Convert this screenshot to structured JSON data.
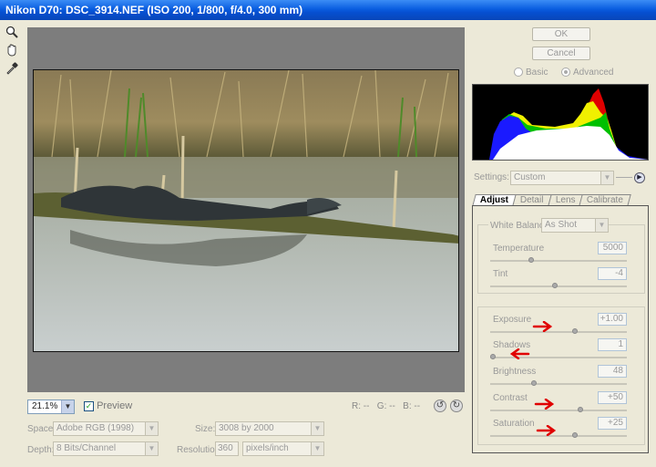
{
  "window": {
    "title": "Nikon D70:  DSC_3914.NEF  (ISO 200, 1/800, f/4.0, 300 mm)"
  },
  "tools": [
    {
      "name": "zoom-tool-icon"
    },
    {
      "name": "hand-tool-icon"
    },
    {
      "name": "white-balance-eyedropper-icon"
    }
  ],
  "buttons": {
    "ok": "OK",
    "cancel": "Cancel"
  },
  "mode": {
    "basic": "Basic",
    "advanced": "Advanced",
    "selected": "Advanced"
  },
  "preview": {
    "zoom": "21.1%",
    "preview_label": "Preview",
    "preview_checked": true,
    "r_label": "R:",
    "g_label": "G:",
    "b_label": "B:",
    "r_value": "--",
    "g_value": "--",
    "b_value": "--"
  },
  "output": {
    "space_label": "Space:",
    "space_value": "Adobe RGB (1998)",
    "size_label": "Size:",
    "size_value": "3008 by 2000",
    "depth_label": "Depth:",
    "depth_value": "8 Bits/Channel",
    "resolution_label": "Resolution:",
    "resolution_value": "360",
    "resolution_unit": "pixels/inch"
  },
  "settings": {
    "label": "Settings:",
    "value": "Custom"
  },
  "tabs": [
    "Adjust",
    "Detail",
    "Lens",
    "Calibrate"
  ],
  "active_tab": "Adjust",
  "white_balance": {
    "label": "White Balance:",
    "value": "As Shot"
  },
  "sliders": {
    "temperature": {
      "label": "Temperature",
      "value": "5000",
      "level": 0.3
    },
    "tint": {
      "label": "Tint",
      "value": "-4",
      "level": 0.47
    },
    "exposure": {
      "label": "Exposure",
      "value": "+1.00",
      "level": 0.62
    },
    "shadows": {
      "label": "Shadows",
      "value": "1",
      "level": 0.02
    },
    "brightness": {
      "label": "Brightness",
      "value": "48",
      "level": 0.32
    },
    "contrast": {
      "label": "Contrast",
      "value": "+50",
      "level": 0.66
    },
    "saturation": {
      "label": "Saturation",
      "value": "+25",
      "level": 0.62
    }
  },
  "colors": {
    "title_blue": "#0a5ee0",
    "annotation_red": "#e00000",
    "preview_gray": "#7d7d7d"
  }
}
